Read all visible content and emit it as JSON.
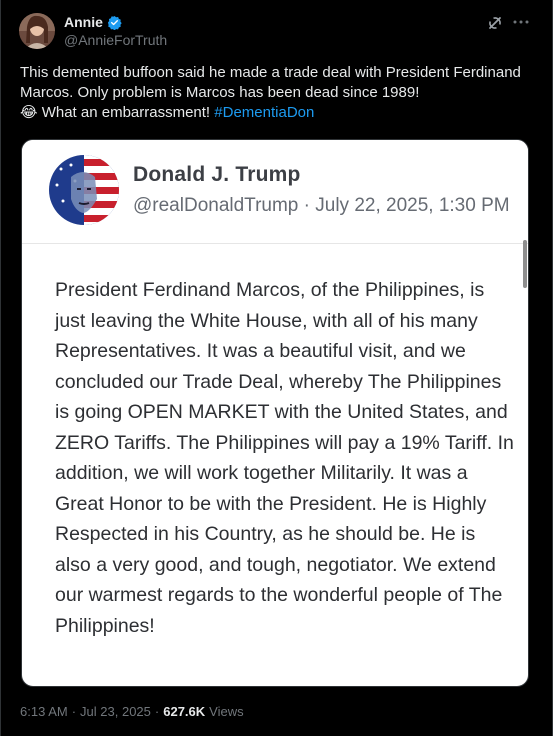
{
  "author": {
    "display_name": "Annie",
    "handle": "@AnnieForTruth"
  },
  "post": {
    "text_main": "This demented buffoon said he made a trade deal with President Ferdinand Marcos. Only problem is Marcos has been dead since 1989!",
    "emoji": "😂",
    "text_tail": "What an embarrassment!",
    "hashtag": "#DementiaDon"
  },
  "embedded": {
    "name": "Donald J. Trump",
    "meta": "@realDonaldTrump · July 22, 2025, 1:30 PM",
    "body": "President Ferdinand Marcos, of the Philippines, is just leaving the White House, with all of his many Representatives. It was a beautiful visit, and we concluded our Trade Deal, whereby The Philippines is going OPEN MARKET with the United States, and ZERO Tariffs. The Philippines will pay a 19% Tariff. In addition, we will work together Militarily. It was a Great Honor to be with the President. He is Highly Respected in his Country, as he should be. He is also a very good, and tough, negotiator. We extend our warmest regards to the wonderful people of The Philippines!"
  },
  "footer": {
    "time": "6:13 AM",
    "date": "Jul 23, 2025",
    "separator": "·",
    "views_count": "627.6K",
    "views_label": "Views"
  },
  "icons": {
    "verified": "verified-badge-icon",
    "grok": "grok-icon",
    "more": "more-options-icon"
  },
  "colors": {
    "background": "#000000",
    "text": "#e7e9ea",
    "muted": "#71767b",
    "link": "#1d9bf0",
    "verified": "#1d9bf0"
  }
}
